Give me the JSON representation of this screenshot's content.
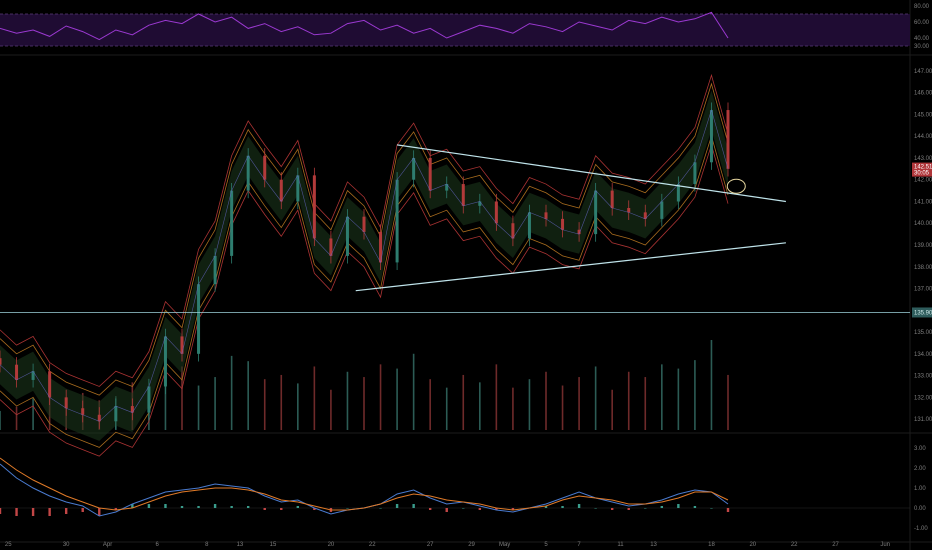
{
  "colors": {
    "background": "#000000",
    "rsi_band": "#1f0c33",
    "rsi_line": "#9b39d1",
    "trendline": "#bfe3ea",
    "level_line": "#9fd3dc",
    "level_flag": "#2e5c5c",
    "price_flag": "#b0363a",
    "up_candle": "#2e7d6f",
    "down_candle": "#b23a3a",
    "macd_line": "#4a7bd0",
    "signal_line": "#e07a28",
    "cloud_green": "#1e3a1e",
    "ellipse": "#e8d8a0"
  },
  "chart_data": [
    {
      "type": "line",
      "panel": "RSI",
      "yticks": [
        "80.00",
        "60.00",
        "40.00",
        "30.00"
      ],
      "band": [
        30,
        70
      ],
      "ylim": [
        25,
        85
      ],
      "x": [
        0,
        4,
        8,
        12,
        16,
        20,
        24,
        28,
        32,
        36,
        40,
        44,
        48,
        52,
        56,
        60,
        64,
        68,
        72,
        76,
        80,
        84,
        88,
        92,
        96,
        100,
        104,
        108,
        112,
        116,
        120,
        124,
        128,
        132,
        136,
        140,
        144,
        148,
        152,
        156,
        160,
        164,
        168,
        172,
        176
      ],
      "values": [
        52,
        46,
        50,
        42,
        55,
        48,
        38,
        50,
        44,
        56,
        62,
        58,
        70,
        60,
        66,
        52,
        58,
        48,
        54,
        44,
        46,
        58,
        62,
        50,
        56,
        46,
        52,
        40,
        48,
        56,
        52,
        46,
        58,
        54,
        48,
        60,
        55,
        50,
        62,
        58,
        66,
        60,
        64,
        72,
        40
      ]
    },
    {
      "type": "candlestick",
      "panel": "Price",
      "yticks": [
        "147.00",
        "146.00",
        "145.00",
        "144.00",
        "143.00",
        "142.00",
        "141.00",
        "140.00",
        "139.00",
        "138.00",
        "137.00",
        "136.00",
        "135.00",
        "134.00",
        "133.00",
        "132.00",
        "131.00"
      ],
      "ylim": [
        130.5,
        147.5
      ],
      "xticks": [
        "25",
        "30",
        "Apr",
        "6",
        "8",
        "13",
        "15",
        "20",
        "22",
        "27",
        "29",
        "May",
        "5",
        "7",
        "11",
        "13",
        "18",
        "20",
        "22",
        "27",
        "Jun",
        "3"
      ],
      "horizontal_level": {
        "value": 135.9,
        "label": "135.90"
      },
      "last_price": {
        "value": 142.51,
        "label": "142.51",
        "countdown": "30:05"
      },
      "trendlines": [
        {
          "from": [
            96,
            143.6
          ],
          "to": [
            190,
            141.0
          ]
        },
        {
          "from": [
            86,
            136.9
          ],
          "to": [
            190,
            139.1
          ]
        }
      ],
      "x": [
        0,
        4,
        8,
        12,
        16,
        20,
        24,
        28,
        32,
        36,
        40,
        44,
        48,
        52,
        56,
        60,
        64,
        68,
        72,
        76,
        80,
        84,
        88,
        92,
        96,
        100,
        104,
        108,
        112,
        116,
        120,
        124,
        128,
        132,
        136,
        140,
        144,
        148,
        152,
        156,
        160,
        164,
        168,
        172,
        176
      ],
      "close": [
        133.5,
        132.8,
        133.2,
        132.0,
        131.5,
        131.2,
        130.9,
        131.6,
        131.3,
        132.5,
        134.8,
        134.0,
        137.2,
        138.5,
        141.5,
        143.1,
        142.0,
        141.0,
        142.2,
        139.3,
        138.5,
        140.3,
        139.6,
        138.2,
        142.0,
        143.0,
        141.5,
        141.8,
        140.8,
        141.0,
        140.0,
        139.3,
        140.5,
        140.2,
        139.7,
        139.5,
        141.5,
        140.7,
        140.5,
        140.2,
        141.0,
        141.8,
        142.8,
        145.2,
        142.5
      ],
      "volume": [
        18,
        22,
        30,
        40,
        25,
        35,
        28,
        32,
        45,
        30,
        55,
        60,
        42,
        50,
        70,
        65,
        48,
        52,
        44,
        60,
        38,
        55,
        50,
        62,
        58,
        72,
        48,
        40,
        52,
        45,
        62,
        40,
        48,
        55,
        42,
        50,
        60,
        38,
        55,
        50,
        62,
        58,
        66,
        85,
        52
      ]
    },
    {
      "type": "bar",
      "panel": "MACD",
      "yticks": [
        "3.00",
        "2.00",
        "1.00",
        "0.00",
        "-1.00"
      ],
      "ylim": [
        -1.6,
        3.6
      ],
      "x": [
        0,
        4,
        8,
        12,
        16,
        20,
        24,
        28,
        32,
        36,
        40,
        44,
        48,
        52,
        56,
        60,
        64,
        68,
        72,
        76,
        80,
        84,
        88,
        92,
        96,
        100,
        104,
        108,
        112,
        116,
        120,
        124,
        128,
        132,
        136,
        140,
        144,
        148,
        152,
        156,
        160,
        164,
        168,
        172,
        176
      ],
      "macd": [
        2.2,
        1.5,
        1.0,
        0.6,
        0.3,
        0.1,
        -0.4,
        -0.2,
        0.2,
        0.5,
        0.8,
        0.9,
        1.0,
        1.2,
        1.1,
        1.0,
        0.6,
        0.3,
        0.4,
        0.0,
        -0.3,
        -0.1,
        0.0,
        0.2,
        0.7,
        0.9,
        0.5,
        0.2,
        0.3,
        0.1,
        -0.1,
        -0.2,
        0.0,
        0.2,
        0.5,
        0.8,
        0.5,
        0.3,
        0.1,
        0.2,
        0.4,
        0.7,
        0.9,
        0.8,
        0.2
      ],
      "signal": [
        2.5,
        1.9,
        1.4,
        1.0,
        0.6,
        0.3,
        0.0,
        -0.1,
        0.0,
        0.3,
        0.6,
        0.8,
        0.9,
        1.0,
        1.0,
        0.9,
        0.7,
        0.4,
        0.3,
        0.1,
        -0.1,
        -0.1,
        0.0,
        0.2,
        0.5,
        0.7,
        0.6,
        0.4,
        0.3,
        0.2,
        0.0,
        -0.1,
        0.0,
        0.1,
        0.4,
        0.6,
        0.5,
        0.4,
        0.2,
        0.2,
        0.3,
        0.5,
        0.8,
        0.8,
        0.4
      ]
    }
  ]
}
